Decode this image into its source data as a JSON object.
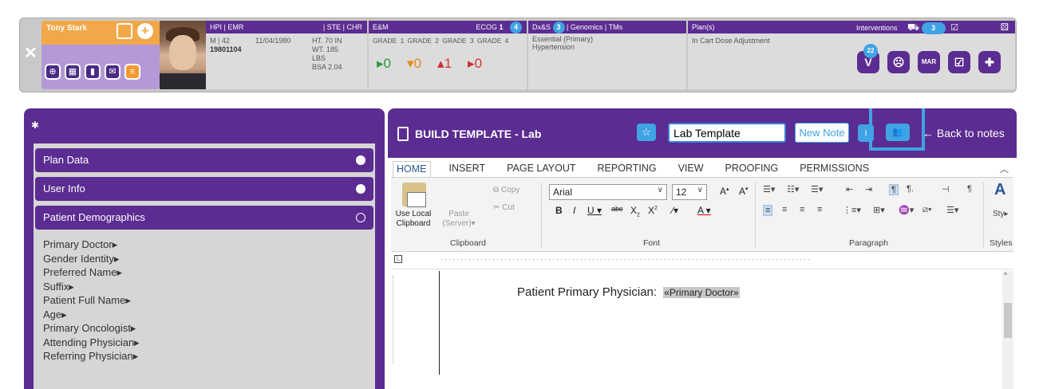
{
  "patient": {
    "name": "Tony Stark",
    "sex_age": "M | 42",
    "mrn": "19801104",
    "dob": "11/04/1980",
    "height": "HT. 70 IN",
    "weight": "WT. 185",
    "weight_unit": "LBS",
    "bsa": "BSA 2.04"
  },
  "hpi": {
    "title": "HPI | EMR",
    "links": "|  STE  |  CHR"
  },
  "em": {
    "title": "E&M",
    "ecog_label": "ECOG",
    "ecog_value": "1",
    "ecog_badge": "4",
    "grade_labels": "GRADE 1  GRADE 2  GRADE 3  GRADE 4",
    "grade_values": [
      "0",
      "0",
      "1",
      "0"
    ]
  },
  "dx": {
    "title": "Dx&S",
    "badge": "3",
    "tail": "| Genomics | TMs",
    "diagnosis_line1": "Essential (Primary)",
    "diagnosis_line2": "Hypertension"
  },
  "plan": {
    "title": "Plan(s)",
    "note": "In Cart Dose Adjustment"
  },
  "interventions": {
    "title": "Interventions",
    "cart_count": "3",
    "v_badge": "22",
    "icons": [
      "V",
      "☹",
      "MAR",
      "☑",
      "✚"
    ]
  },
  "left_panel": {
    "sections": [
      {
        "label": "Plan Data"
      },
      {
        "label": "User Info"
      },
      {
        "label": "Patient Demographics"
      }
    ],
    "fields": [
      "Primary Doctor▸",
      "Gender Identity▸",
      "Preferred Name▸",
      "Suffix▸",
      "Patient Full Name▸",
      "Age▸",
      "Primary Oncologist▸",
      "Attending Physician▸",
      "Referring Physician▸"
    ]
  },
  "editor": {
    "title": "BUILD TEMPLATE - Lab",
    "template_name": "Lab Template",
    "new_note": "New Note",
    "back": "←  Back to notes",
    "tabs": [
      "HOME",
      "INSERT",
      "PAGE LAYOUT",
      "REPORTING",
      "VIEW",
      "PROOFING",
      "PERMISSIONS"
    ],
    "clipboard": {
      "use_local_l1": "Use Local",
      "use_local_l2": "Clipboard",
      "paste_l1": "Paste",
      "paste_l2": "(Server)▾",
      "copy": "Copy",
      "cut": "Cut",
      "group": "Clipboard"
    },
    "font": {
      "family": "Arial",
      "size": "12",
      "group": "Font"
    },
    "paragraph_group": "Paragraph",
    "styles_group": "Styles",
    "styles_short": "Sty▸",
    "document_label": "Patient Primary Physician:",
    "merge_field": "«Primary Doctor»"
  }
}
